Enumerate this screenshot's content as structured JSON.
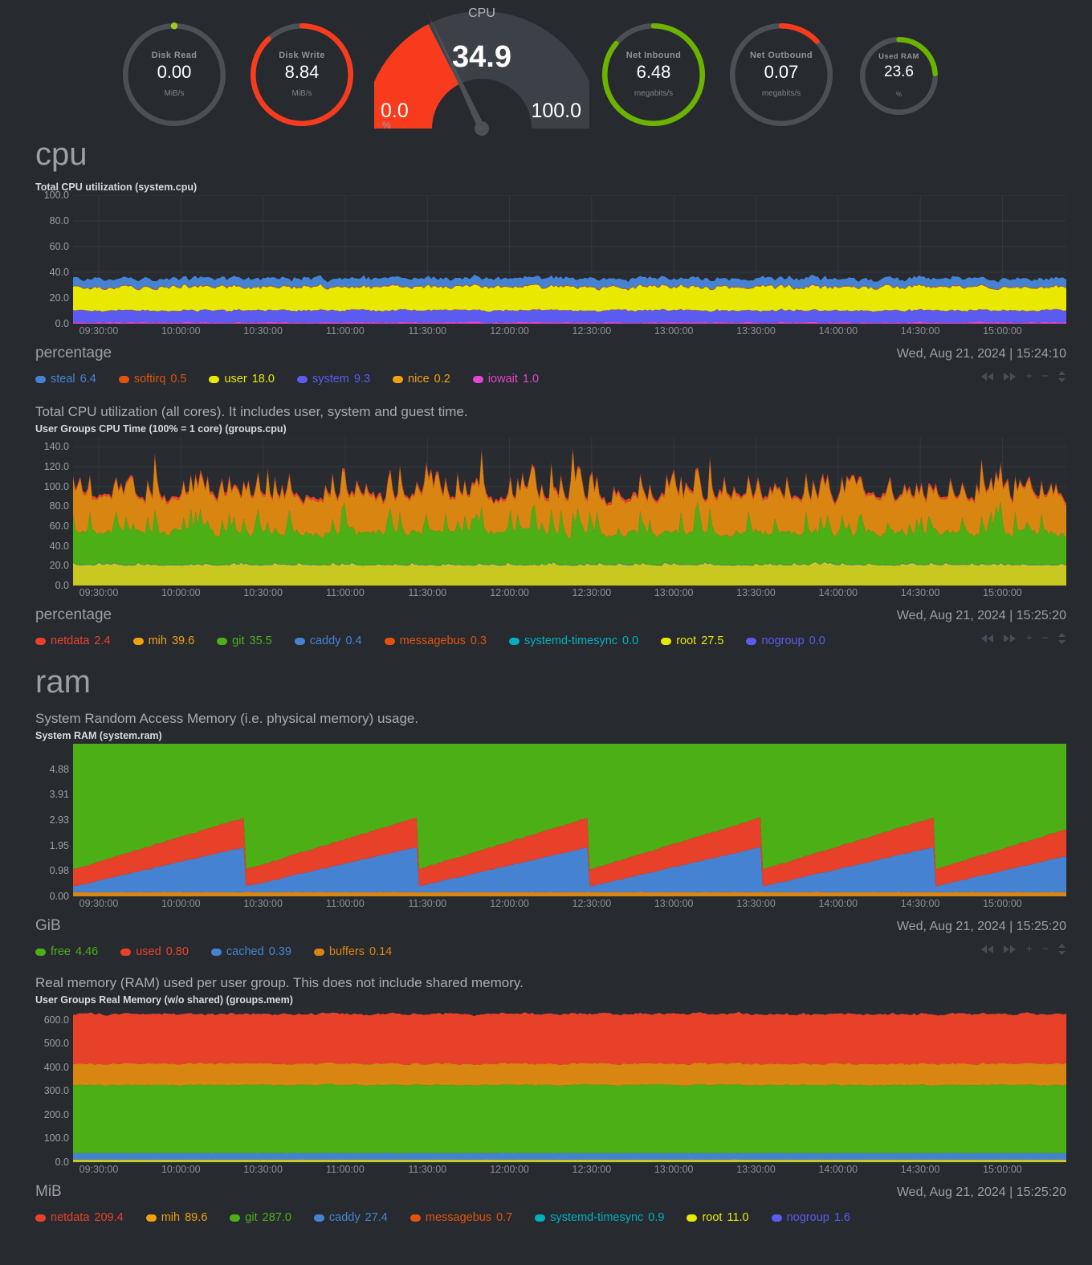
{
  "gauges": [
    {
      "name": "Disk Read",
      "value": "0.00",
      "units": "MiB/s",
      "pct": 0,
      "color": "#4d5358",
      "accent": "#9ccc1e",
      "dot": true
    },
    {
      "name": "Disk Write",
      "value": "8.84",
      "units": "MiB/s",
      "pct": 88,
      "color": "#f93b1d",
      "accent": "#f93b1d",
      "dot": false
    },
    {
      "name": "Net Inbound",
      "value": "6.48",
      "units": "megabits/s",
      "pct": 86,
      "color": "#6cb300",
      "accent": "#6cb300",
      "dot": false
    },
    {
      "name": "Net Outbound",
      "value": "0.07",
      "units": "megabits/s",
      "pct": 13,
      "color": "#f93b1d",
      "accent": "#f93b1d",
      "dot": false
    },
    {
      "name": "Used RAM",
      "value": "23.6",
      "units": "%",
      "pct": 24,
      "color": "#6cb300",
      "accent": "#6cb300",
      "dot": false
    }
  ],
  "speedometer": {
    "title": "CPU",
    "value": "34.9",
    "min": "0.0",
    "max": "100.0",
    "units": "%",
    "fill_color": "#f93b1d",
    "track_color": "#3c4147"
  },
  "sections": [
    {
      "id": "cpu",
      "title": "cpu"
    },
    {
      "id": "ram",
      "title": "ram"
    }
  ],
  "charts": [
    {
      "id": "system-cpu",
      "description": "",
      "name": "Total CPU utilization (system.cpu)",
      "units": "percentage",
      "timestamp": "Wed, Aug 21, 2024 | 15:24:10",
      "legend": [
        {
          "label": "steal",
          "value": "6.4",
          "color": "#4682d2"
        },
        {
          "label": "softirq",
          "value": "0.5",
          "color": "#e2520d"
        },
        {
          "label": "user",
          "value": "18.0",
          "color": "#e8e800"
        },
        {
          "label": "system",
          "value": "9.3",
          "color": "#5b5bf0"
        },
        {
          "label": "nice",
          "value": "0.2",
          "color": "#f0a010"
        },
        {
          "label": "iowait",
          "value": "1.0",
          "color": "#e346d2"
        }
      ],
      "chart_data": {
        "type": "area",
        "title": "Total CPU utilization (system.cpu)",
        "ylabel": "percentage",
        "ylim": [
          0,
          100
        ],
        "yticks": [
          "0.0",
          "20.0",
          "40.0",
          "60.0",
          "80.0",
          "100.0"
        ],
        "xticks": [
          "09:30:00",
          "10:00:00",
          "10:30:00",
          "11:00:00",
          "11:30:00",
          "12:00:00",
          "12:30:00",
          "13:00:00",
          "13:30:00",
          "14:00:00",
          "14:30:00",
          "15:00:00"
        ],
        "stacked": true,
        "grid": true,
        "legend_position": "bottom",
        "series": [
          {
            "name": "iowait",
            "color": "#e346d2",
            "mean": 1.0,
            "amp": 1.6
          },
          {
            "name": "system",
            "color": "#5b5bf0",
            "mean": 9.3,
            "amp": 2.0
          },
          {
            "name": "nice",
            "color": "#f0a010",
            "mean": 0.2,
            "amp": 0.3
          },
          {
            "name": "user",
            "color": "#e8e800",
            "mean": 18.0,
            "amp": 5.0
          },
          {
            "name": "softirq",
            "color": "#e2520d",
            "mean": 0.5,
            "amp": 0.4
          },
          {
            "name": "steal",
            "color": "#4682d2",
            "mean": 6.4,
            "amp": 3.0
          }
        ]
      }
    },
    {
      "id": "groups-cpu",
      "description": "Total CPU utilization (all cores). It includes user, system and guest time.",
      "name": "User Groups CPU Time (100% = 1 core) (groups.cpu)",
      "units": "percentage",
      "timestamp": "Wed, Aug 21, 2024 | 15:25:20",
      "legend": [
        {
          "label": "netdata",
          "value": "2.4",
          "color": "#e8412a"
        },
        {
          "label": "mih",
          "value": "39.6",
          "color": "#f0a010"
        },
        {
          "label": "git",
          "value": "35.5",
          "color": "#4caf16"
        },
        {
          "label": "caddy",
          "value": "0.4",
          "color": "#4682d2"
        },
        {
          "label": "messagebus",
          "value": "0.3",
          "color": "#e2520d"
        },
        {
          "label": "systemd-timesync",
          "value": "0.0",
          "color": "#00b0c0"
        },
        {
          "label": "root",
          "value": "27.5",
          "color": "#e8e800"
        },
        {
          "label": "nogroup",
          "value": "0.0",
          "color": "#5b5bf0"
        }
      ],
      "chart_data": {
        "type": "area",
        "title": "User Groups CPU Time (100% = 1 core) (groups.cpu)",
        "ylabel": "percentage",
        "ylim": [
          0,
          150
        ],
        "yticks": [
          "0.0",
          "20.0",
          "40.0",
          "60.0",
          "80.0",
          "100.0",
          "120.0",
          "140.0"
        ],
        "xticks": [
          "09:30:00",
          "10:00:00",
          "10:30:00",
          "11:00:00",
          "11:30:00",
          "12:00:00",
          "12:30:00",
          "13:00:00",
          "13:30:00",
          "14:00:00",
          "14:30:00",
          "15:00:00"
        ],
        "stacked": true,
        "grid": true,
        "legend_position": "bottom",
        "series": [
          {
            "name": "root",
            "color": "#c8c820",
            "mean": 27.5,
            "amp": 2.5
          },
          {
            "name": "caddy",
            "color": "#4682d2",
            "mean": 0.4,
            "amp": 0.6
          },
          {
            "name": "git",
            "color": "#4caf16",
            "mean": 35.5,
            "amp": 22.0
          },
          {
            "name": "mih",
            "color": "#d98512",
            "mean": 39.6,
            "amp": 20.0
          },
          {
            "name": "netdata",
            "color": "#e8412a",
            "mean": 2.4,
            "amp": 2.0
          }
        ]
      }
    },
    {
      "id": "system-ram",
      "description": "System Random Access Memory (i.e. physical memory) usage.",
      "name": "System RAM (system.ram)",
      "units": "GiB",
      "timestamp": "Wed, Aug 21, 2024 | 15:25:20",
      "legend": [
        {
          "label": "free",
          "value": "4.46",
          "color": "#4caf16"
        },
        {
          "label": "used",
          "value": "0.80",
          "color": "#e8412a"
        },
        {
          "label": "cached",
          "value": "0.39",
          "color": "#4682d2"
        },
        {
          "label": "buffers",
          "value": "0.14",
          "color": "#d98512"
        }
      ],
      "chart_data": {
        "type": "area",
        "title": "System RAM (system.ram)",
        "ylabel": "GiB",
        "ylim": [
          0,
          5.86
        ],
        "yticks": [
          "0.00",
          "0.98",
          "1.95",
          "2.93",
          "3.91",
          "4.88"
        ],
        "xticks": [
          "09:30:00",
          "10:00:00",
          "10:30:00",
          "11:00:00",
          "11:30:00",
          "12:00:00",
          "12:30:00",
          "13:00:00",
          "13:30:00",
          "14:00:00",
          "14:30:00",
          "15:00:00"
        ],
        "stacked": true,
        "grid": false,
        "legend_position": "bottom",
        "note": "sawtooth cache-fill pattern resetting roughly every hour",
        "series": [
          {
            "name": "buffers",
            "color": "#d98512",
            "mean": 0.14
          },
          {
            "name": "cached",
            "color": "#4682d2",
            "mean": 0.39
          },
          {
            "name": "used",
            "color": "#e8412a",
            "mean": 0.8
          },
          {
            "name": "free",
            "color": "#4caf16",
            "mean": 4.46
          }
        ]
      }
    },
    {
      "id": "groups-mem",
      "description": "Real memory (RAM) used per user group. This does not include shared memory.",
      "name": "User Groups Real Memory (w/o shared) (groups.mem)",
      "units": "MiB",
      "timestamp": "Wed, Aug 21, 2024 | 15:25:20",
      "legend": [
        {
          "label": "netdata",
          "value": "209.4",
          "color": "#e8412a"
        },
        {
          "label": "mih",
          "value": "89.6",
          "color": "#f0a010"
        },
        {
          "label": "git",
          "value": "287.0",
          "color": "#4caf16"
        },
        {
          "label": "caddy",
          "value": "27.4",
          "color": "#4682d2"
        },
        {
          "label": "messagebus",
          "value": "0.7",
          "color": "#e2520d"
        },
        {
          "label": "systemd-timesync",
          "value": "0.9",
          "color": "#00b0c0"
        },
        {
          "label": "root",
          "value": "11.0",
          "color": "#e8e800"
        },
        {
          "label": "nogroup",
          "value": "1.6",
          "color": "#5b5bf0"
        }
      ],
      "chart_data": {
        "type": "area",
        "title": "User Groups Real Memory (w/o shared) (groups.mem)",
        "ylabel": "MiB",
        "ylim": [
          0,
          650
        ],
        "yticks": [
          "0.0",
          "100.0",
          "200.0",
          "300.0",
          "400.0",
          "500.0",
          "600.0"
        ],
        "xticks": [
          "09:30:00",
          "10:00:00",
          "10:30:00",
          "11:00:00",
          "11:30:00",
          "12:00:00",
          "12:30:00",
          "13:00:00",
          "13:30:00",
          "14:00:00",
          "14:30:00",
          "15:00:00"
        ],
        "stacked": true,
        "grid": false,
        "legend_position": "bottom",
        "series": [
          {
            "name": "root",
            "color": "#c8c820",
            "mean": 11.0,
            "amp": 1.0
          },
          {
            "name": "caddy",
            "color": "#4682d2",
            "mean": 27.4,
            "amp": 2.0
          },
          {
            "name": "git",
            "color": "#4caf16",
            "mean": 287.0,
            "amp": 10.0
          },
          {
            "name": "mih",
            "color": "#d98512",
            "mean": 89.6,
            "amp": 8.0
          },
          {
            "name": "netdata",
            "color": "#e8412a",
            "mean": 209.4,
            "amp": 12.0
          }
        ]
      }
    }
  ],
  "controls": {
    "rewind": "rewind-icon",
    "forward": "forward-icon",
    "zoom_in": "+",
    "zoom_out": "−",
    "resize": "resize-icon"
  }
}
